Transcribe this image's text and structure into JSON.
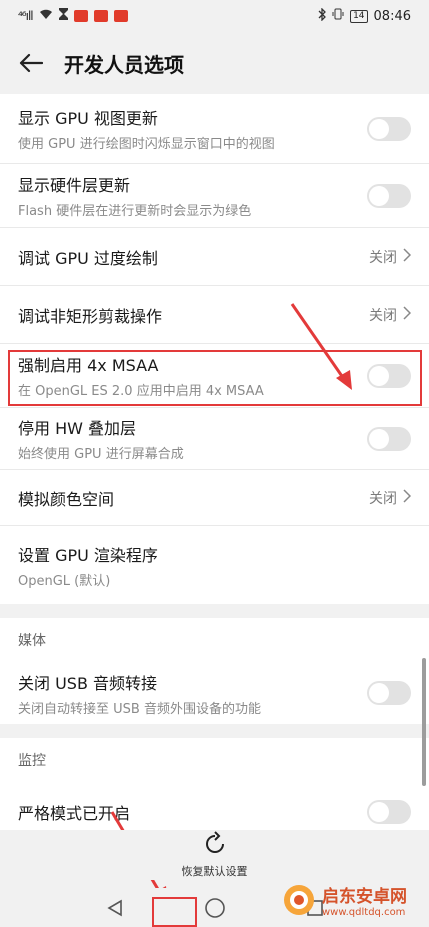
{
  "status_bar": {
    "signal": "⁴⁶ıll",
    "time": "08:46",
    "battery": "14"
  },
  "header": {
    "title": "开发人员选项"
  },
  "rows": [
    {
      "title": "显示 GPU 视图更新",
      "subtitle": "使用 GPU 进行绘图时闪烁显示窗口中的视图",
      "control": "toggle"
    },
    {
      "title": "显示硬件层更新",
      "subtitle": "Flash 硬件层在进行更新时会显示为绿色",
      "control": "toggle"
    },
    {
      "title": "调试 GPU 过度绘制",
      "value": "关闭"
    },
    {
      "title": "调试非矩形剪裁操作",
      "value": "关闭"
    },
    {
      "title": "强制启用 4x MSAA",
      "subtitle": "在 OpenGL ES 2.0 应用中启用 4x MSAA",
      "control": "toggle"
    },
    {
      "title": "停用 HW 叠加层",
      "subtitle": "始终使用 GPU 进行屏幕合成",
      "control": "toggle"
    },
    {
      "title": "模拟颜色空间",
      "value": "关闭"
    },
    {
      "title": "设置 GPU 渲染程序",
      "subtitle": "OpenGL (默认)"
    }
  ],
  "media": {
    "section_title": "媒体",
    "row": {
      "title": "关闭 USB 音频转接",
      "subtitle": "关闭自动转接至 USB 音频外围设备的功能"
    }
  },
  "monitor": {
    "section_title": "监控",
    "row": {
      "title": "严格模式已开启"
    }
  },
  "bottom": {
    "restore_label": "恢复默认设置"
  },
  "watermark": {
    "title": "启东安卓网",
    "url": "www.qdltdq.com"
  },
  "colors": {
    "highlight": "#e33a3a",
    "watermark": "#d5532b"
  }
}
